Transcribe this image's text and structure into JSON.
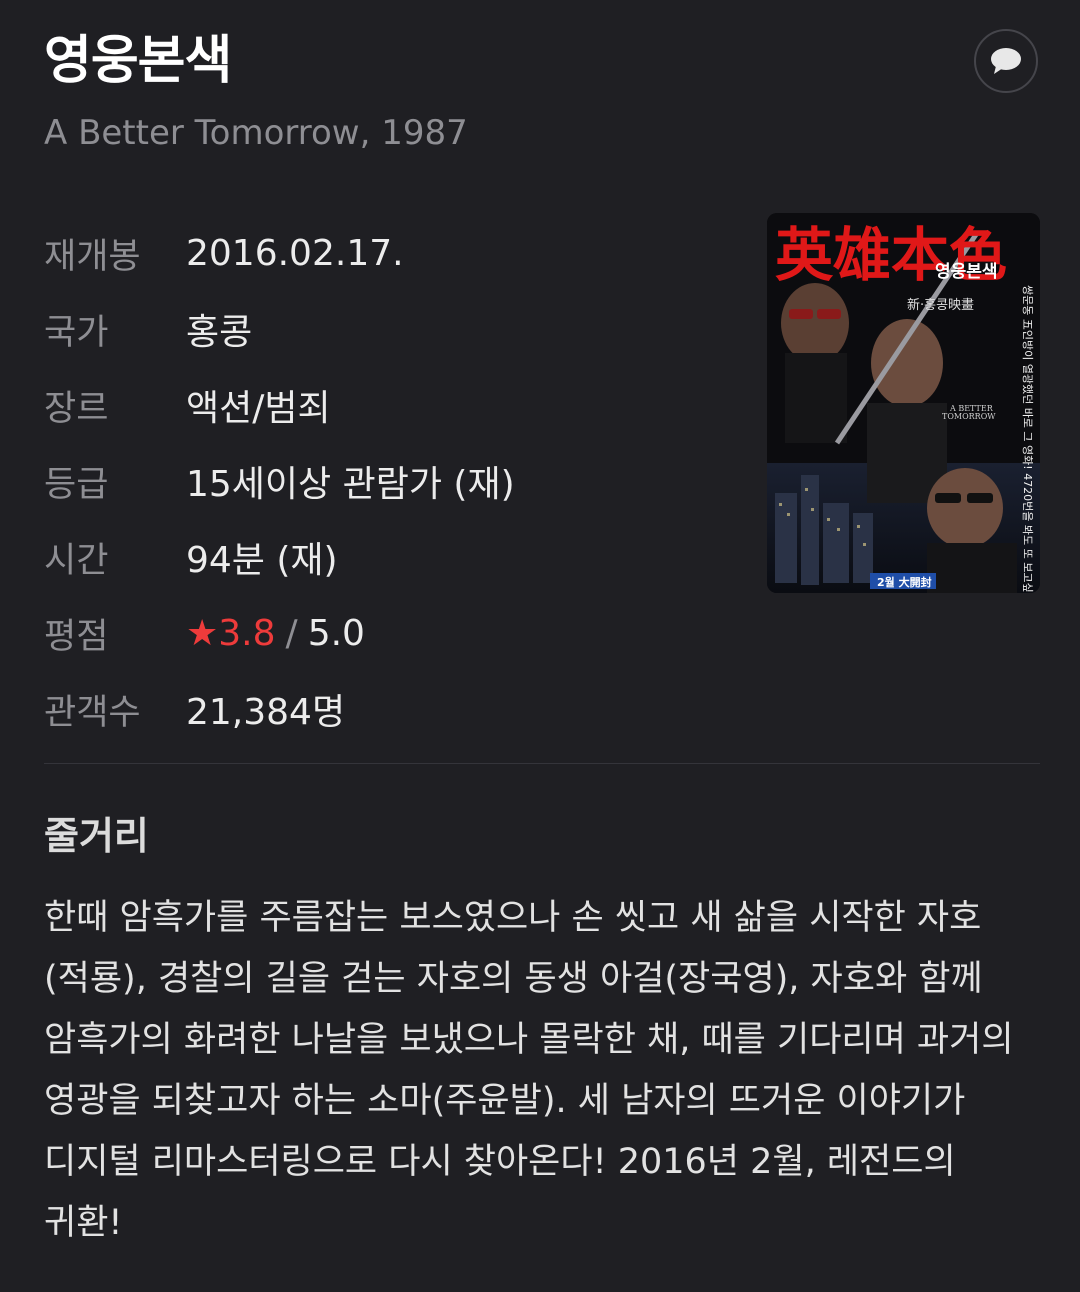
{
  "movie": {
    "title": "영웅본색",
    "subtitle": "A Better Tomorrow, 1987"
  },
  "actions": {
    "comment_icon": "speech-bubble-icon"
  },
  "info": {
    "release_label": "재개봉",
    "release_value": "2016.02.17.",
    "country_label": "국가",
    "country_value": "홍콩",
    "genre_label": "장르",
    "genre_value": "액션/범죄",
    "rating_label": "등급",
    "rating_value": "15세이상 관람가 (재)",
    "runtime_label": "시간",
    "runtime_value": "94분 (재)",
    "score_label": "평점",
    "score_star": "★",
    "score_value": "3.8",
    "score_separator": "/",
    "score_max": "5.0",
    "audience_label": "관객수",
    "audience_value": "21,384명"
  },
  "poster": {
    "title_cn": "英雄本色",
    "title_kr": "영웅본색",
    "studio": "新·홍콩映畫",
    "en_title_line1": "A BETTER",
    "en_title_line2": "TOMORROW",
    "tagline": "쌍문동 五인방이 열광했던 바로 그 영화! 4720번을 봐도 또 보고싶다!",
    "release_note": "2월 大開封"
  },
  "synopsis": {
    "heading": "줄거리",
    "text": "한때 암흑가를 주름잡는 보스였으나 손 씻고 새 삶을 시작한 자호(적룡), 경찰의 길을 걷는 자호의 동생 아걸(장국영), 자호와 함께 암흑가의 화려한 나날을 보냈으나 몰락한 채, 때를 기다리며 과거의 영광을 되찾고자 하는 소마(주윤발). 세 남자의 뜨거운 이야기가 디지털 리마스터링으로 다시 찾아온다! 2016년 2월, 레전드의 귀환!"
  },
  "colors": {
    "background": "#1f1f23",
    "label": "#8e8e93",
    "accent_red": "#ee3b3b"
  }
}
